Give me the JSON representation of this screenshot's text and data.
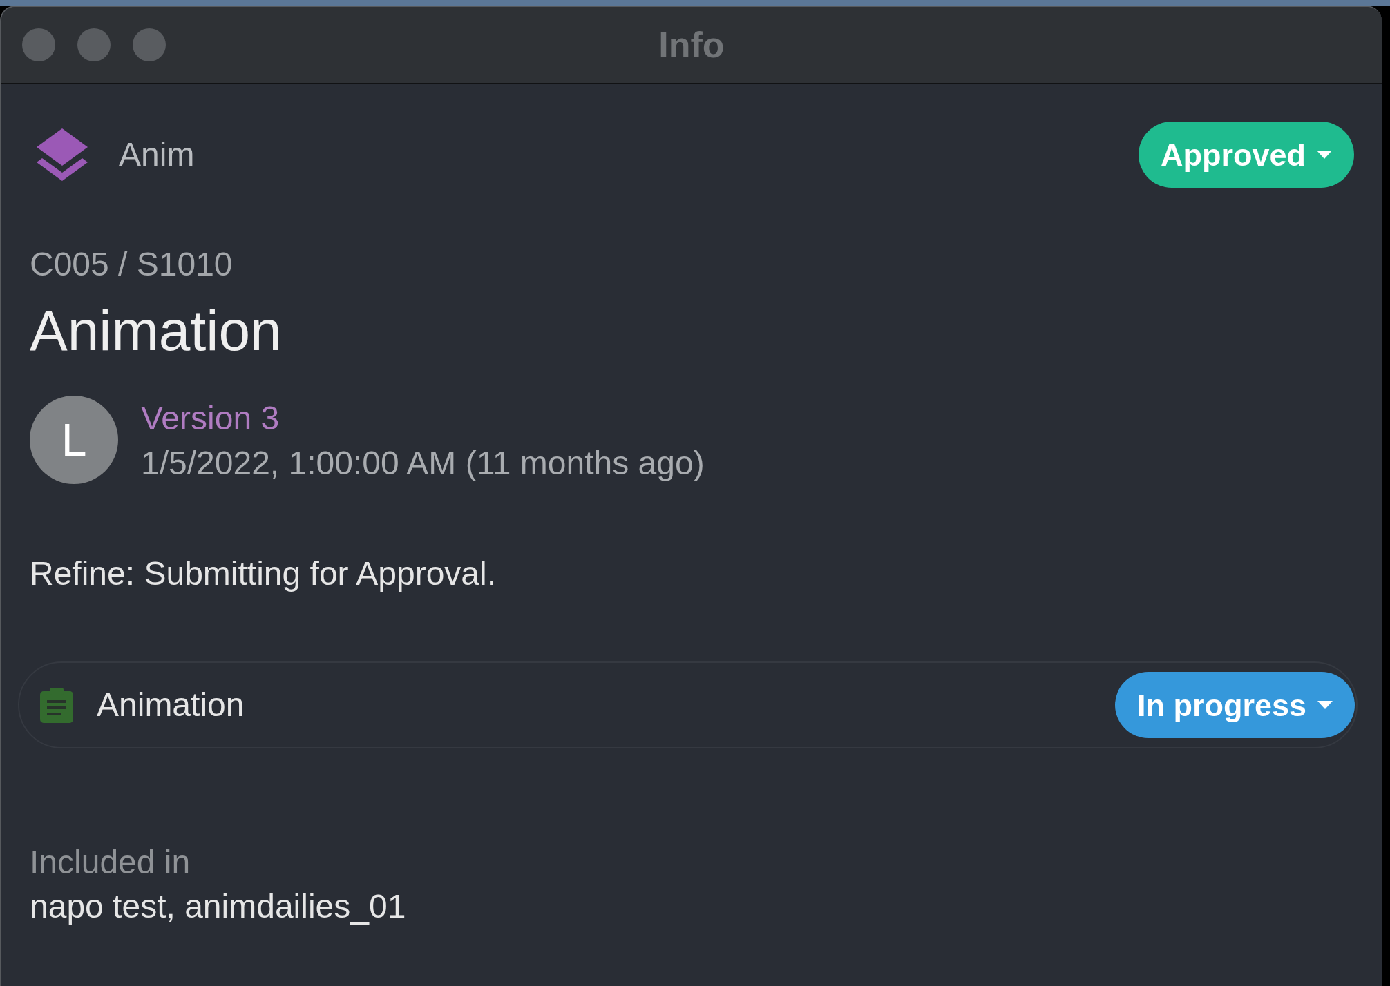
{
  "window": {
    "title": "Info"
  },
  "header": {
    "entity_type": "Anim",
    "status": {
      "label": "Approved",
      "color": "#1fbb8f"
    }
  },
  "breadcrumb": "C005 / S1010",
  "title": "Animation",
  "version": {
    "avatar_initial": "L",
    "label": "Version 3",
    "timestamp": "1/5/2022, 1:00:00 AM (11 months ago)"
  },
  "description": "Refine: Submitting for Approval.",
  "tasks": [
    {
      "name": "Animation",
      "status": {
        "label": "In progress",
        "color": "#3598db"
      }
    }
  ],
  "included_in": {
    "label": "Included in",
    "value": "napo test, animdailies_01"
  }
}
